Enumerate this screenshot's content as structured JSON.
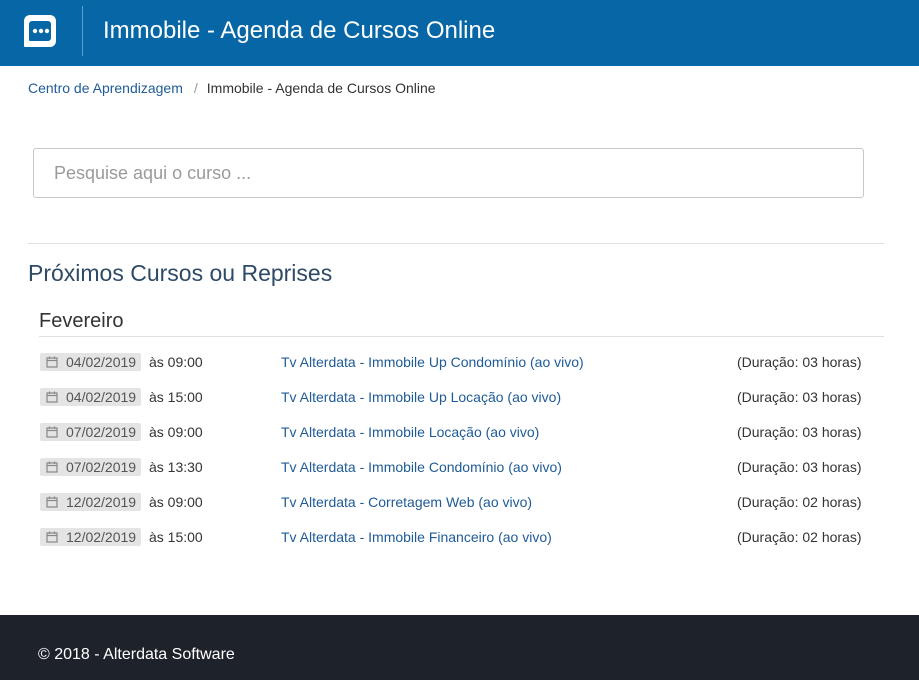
{
  "header": {
    "title": "Immobile - Agenda de Cursos Online",
    "logo_icon": "chat-bubble-icon",
    "background_color": "#0767a6"
  },
  "breadcrumb": {
    "parent": "Centro de Aprendizagem",
    "separator": "/",
    "current": "Immobile - Agenda de Cursos Online"
  },
  "search": {
    "placeholder": "Pesquise aqui o curso ...",
    "value": ""
  },
  "section": {
    "title": "Próximos Cursos ou Reprises"
  },
  "month": {
    "name": "Fevereiro"
  },
  "courses": [
    {
      "date": "04/02/2019",
      "time": "às 09:00",
      "title": "Tv Alterdata - Immobile Up Condomínio (ao vivo)",
      "duration": "(Duração: 03 horas)"
    },
    {
      "date": "04/02/2019",
      "time": "às 15:00",
      "title": "Tv Alterdata - Immobile Up Locação (ao vivo)",
      "duration": "(Duração: 03 horas)"
    },
    {
      "date": "07/02/2019",
      "time": "às 09:00",
      "title": "Tv Alterdata - Immobile Locação (ao vivo)",
      "duration": "(Duração: 03 horas)"
    },
    {
      "date": "07/02/2019",
      "time": "às 13:30",
      "title": "Tv Alterdata - Immobile Condomínio (ao vivo)",
      "duration": "(Duração: 03 horas)"
    },
    {
      "date": "12/02/2019",
      "time": "às 09:00",
      "title": "Tv Alterdata - Corretagem Web (ao vivo)",
      "duration": "(Duração: 02 horas)"
    },
    {
      "date": "12/02/2019",
      "time": "às 15:00",
      "title": "Tv Alterdata - Immobile Financeiro (ao vivo)",
      "duration": "(Duração: 02 horas)"
    }
  ],
  "footer": {
    "text": "© 2018 - Alterdata Software",
    "background_color": "#1e222a"
  }
}
